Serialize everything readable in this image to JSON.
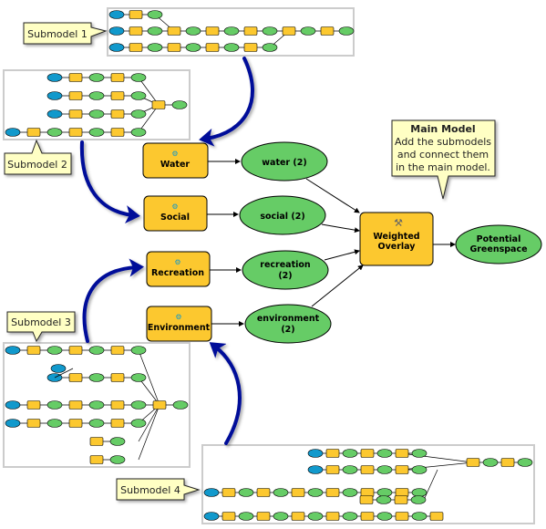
{
  "callouts": {
    "submodel1": "Submodel 1",
    "submodel2": "Submodel 2",
    "submodel3": "Submodel 3",
    "submodel4": "Submodel 4",
    "main_title": "Main Model",
    "main_line1": "Add the submodels",
    "main_line2": "and connect them",
    "main_line3": "in the main model."
  },
  "tools": {
    "water": "Water",
    "social": "Social",
    "recreation": "Recreation",
    "environment": "Environment",
    "weighted_overlay_1": "Weighted",
    "weighted_overlay_2": "Overlay"
  },
  "outputs": {
    "water": "water (2)",
    "social": "social (2)",
    "recreation_1": "recreation",
    "recreation_2": "(2)",
    "environment_1": "environment",
    "environment_2": "(2)",
    "greenspace_1": "Potential",
    "greenspace_2": "Greenspace"
  },
  "colors": {
    "tool": "#fcc82f",
    "data": "#66cc66",
    "input": "#1199cc",
    "arrow": "#001199",
    "callout": "#ffffc4"
  }
}
